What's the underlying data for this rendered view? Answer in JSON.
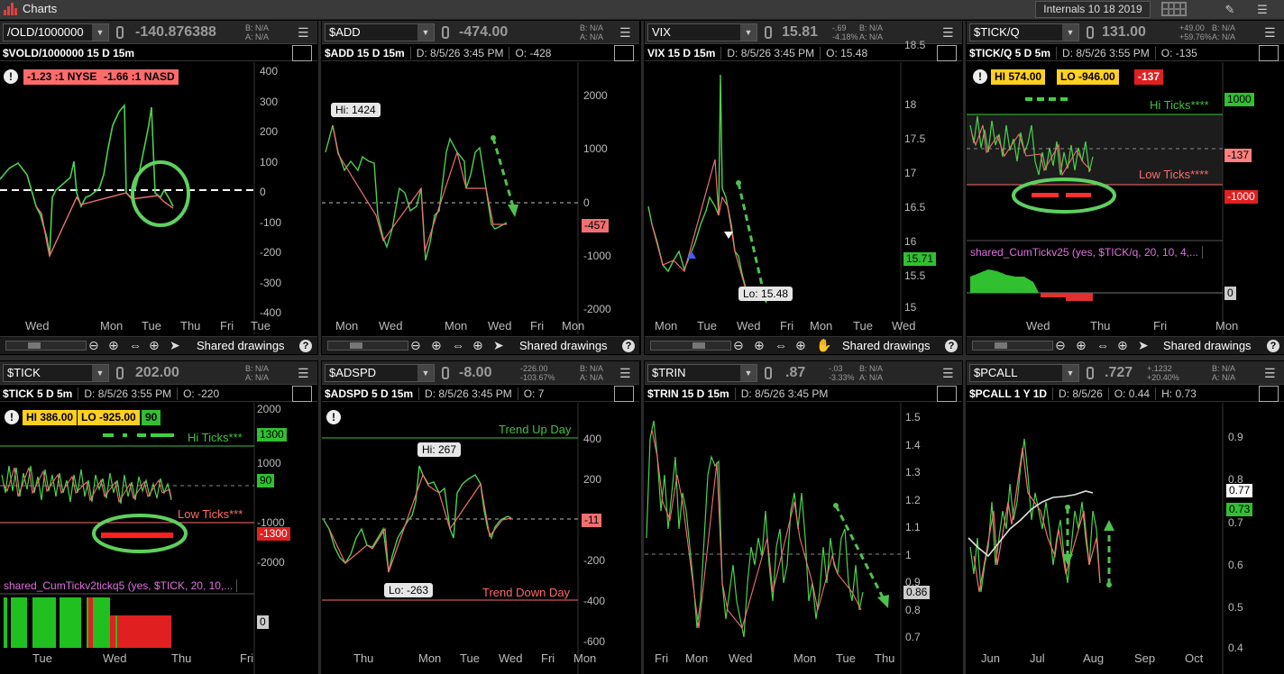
{
  "app": {
    "title": "Charts",
    "workspace": "Internals 10 18 2019",
    "colors": {
      "up": "#4cd14c",
      "down": "#f07070",
      "accent_green": "#3fc93f",
      "accent_red": "#ff4a4a",
      "background": "#000000"
    }
  },
  "navbar": {
    "shared_drawings": "Shared drawings"
  },
  "panels": [
    {
      "symbol": "/OLD/1000000",
      "last": "-140.876388",
      "change": "",
      "pct": "",
      "bid": "B: N/A",
      "ask": "A: N/A",
      "study": "$VOLD/1000000 15 D 15m",
      "fields": [],
      "badges": [
        "-1.23 :1 NYSE",
        "-1.66 :1 NASD"
      ],
      "y_labels": [
        "400",
        "300",
        "200",
        "100",
        "0",
        "-100",
        "-200",
        "-300",
        "-400"
      ],
      "x_labels": [
        "Wed",
        "Mon",
        "Tue",
        "Thu",
        "Fri",
        "Tue"
      ]
    },
    {
      "symbol": "$ADD",
      "last": "-474.00",
      "change": "",
      "pct": "",
      "bid": "B: N/A",
      "ask": "A: N/A",
      "study": "$ADD 15 D 15m",
      "fields": [
        "D: 8/5/26 3:45 PM",
        "O: -428"
      ],
      "hi": "Hi: 1424",
      "tag": "-457",
      "y_labels": [
        "2000",
        "1000",
        "0",
        "-1000",
        "-2000"
      ],
      "x_labels": [
        "Mon",
        "Wed",
        "Mon",
        "Wed",
        "Fri",
        "Mon"
      ]
    },
    {
      "symbol": "VIX",
      "last": "15.81",
      "change": "-.69",
      "pct": "-4.18%",
      "bid": "B: N/A",
      "ask": "A: N/A",
      "study": "VIX 15 D 15m",
      "fields": [
        "D: 8/5/26 3:45 PM",
        "O: 15.48"
      ],
      "lo": "Lo: 15.48",
      "tag": "15.71",
      "y_labels": [
        "18.5",
        "18",
        "17.5",
        "17",
        "16.5",
        "16",
        "15.5",
        "15"
      ],
      "x_labels": [
        "Mon",
        "Tue",
        "Wed",
        "Fri",
        "Mon",
        "Tue",
        "Wed"
      ]
    },
    {
      "symbol": "$TICK/Q",
      "last": "131.00",
      "change": "+49.00",
      "pct": "+59.76%",
      "bid": "B: N/A",
      "ask": "A: N/A",
      "study": "$TICK/Q 5 D 5m",
      "fields": [
        "D: 8/5/26 3:55 PM",
        "O: -135"
      ],
      "badges": [
        "HI 574.00",
        "LO -946.00",
        "-137"
      ],
      "hi_label": "Hi Ticks****",
      "lo_label": "Low Ticks****",
      "tags": [
        "1000",
        "-137",
        "-1000"
      ],
      "sub_study": "shared_CumTickv25 (yes, $TICK/q, 20, 10, 4,...",
      "sub_tag": "0",
      "x_labels": [
        "Wed",
        "Thu",
        "Fri",
        "Mon"
      ]
    },
    {
      "symbol": "$TICK",
      "last": "202.00",
      "change": "",
      "pct": "",
      "bid": "B: N/A",
      "ask": "A: N/A",
      "study": "$TICK 5 D 5m",
      "fields": [
        "D: 8/5/26 3:55 PM",
        "O: -220"
      ],
      "badges": [
        "HI 386.00",
        "LO -925.00",
        "90"
      ],
      "hi_label": "Hi Ticks***",
      "lo_label": "Low Ticks***",
      "y_labels": [
        "2000",
        "1000",
        "-1000",
        "-2000"
      ],
      "tags": [
        "1300",
        "90",
        "-1300"
      ],
      "sub_study": "shared_CumTickv2tickq5 (yes, $TICK, 20, 10,...",
      "sub_tag": "0",
      "x_labels": [
        "Tue",
        "Wed",
        "Thu",
        "Fri"
      ]
    },
    {
      "symbol": "$ADSPD",
      "last": "-8.00",
      "change": "-226.00",
      "pct": "-103.67%",
      "bid": "B: N/A",
      "ask": "A: N/A",
      "study": "$ADSPD 5 D 15m",
      "fields": [
        "D: 8/5/26 3:45 PM",
        "O: 7"
      ],
      "hi": "Hi: 267",
      "lo": "Lo: -263",
      "up_label": "Trend Up Day",
      "down_label": "Trend Down Day",
      "tag": "-11",
      "y_labels": [
        "400",
        "200",
        "-200",
        "-400",
        "-600"
      ],
      "x_labels": [
        "Thu",
        "Mon",
        "Tue",
        "Wed",
        "Fri",
        "Mon"
      ]
    },
    {
      "symbol": "$TRIN",
      "last": ".87",
      "change": "-.03",
      "pct": "-3.33%",
      "bid": "B: N/A",
      "ask": "A: N/A",
      "study": "$TRIN 15 D 15m",
      "fields": [
        "D: 8/5/26 3:45 PM"
      ],
      "tag": "0.86",
      "y_labels": [
        "1.5",
        "1.4",
        "1.3",
        "1.2",
        "1.1",
        "1",
        "0.9",
        "0.8",
        "0.7"
      ],
      "x_labels": [
        "Fri",
        "Mon",
        "Wed",
        "Mon",
        "Tue",
        "Thu"
      ]
    },
    {
      "symbol": "$PCALL",
      "last": ".727",
      "change": "+.1232",
      "pct": "+20.40%",
      "bid": "B: N/A",
      "ask": "A: N/A",
      "study": "$PCALL 1 Y 1D",
      "fields": [
        "D: 8/5/26",
        "O: 0.44",
        "H: 0.73"
      ],
      "tags": [
        "0.77",
        "0.73"
      ],
      "y_labels": [
        "0.9",
        "0.8",
        "0.7",
        "0.6",
        "0.5",
        "0.4"
      ],
      "x_labels": [
        "Jun",
        "Jul",
        "Aug",
        "Sep",
        "Oct"
      ]
    }
  ]
}
